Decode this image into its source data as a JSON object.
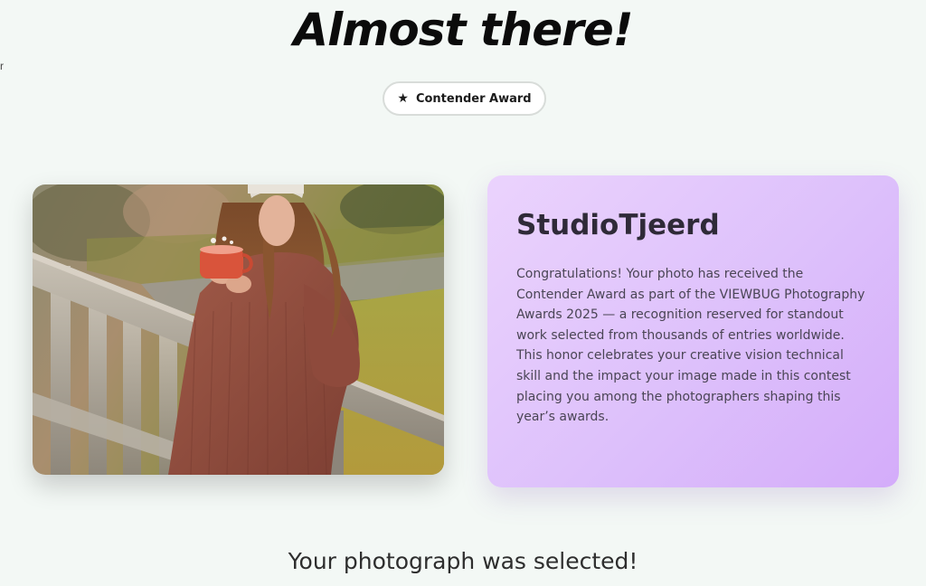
{
  "edge_glyph": "r",
  "headline": "Almost there!",
  "award_badge": {
    "icon": "star-icon",
    "icon_glyph": "★",
    "label": "Contender Award"
  },
  "photo": {
    "icon": "photo-image",
    "alt": "Woman in knit sweater holding a mug beside wooden fence"
  },
  "info_card": {
    "artist": "StudioTjeerd",
    "description": "Congratulations! Your photo has received the Contender Award as part of the VIEWBUG Photography Awards 2025 — a recognition reserved for standout work selected from thousands of entries worldwide. This honor celebrates your creative vision technical skill and the impact your image made in this contest placing you among the photographers shaping this year’s awards."
  },
  "selected_caption": "Your photograph was selected!",
  "colors": {
    "background": "#f3f8f5",
    "card_gradient_start": "#ebd3fd",
    "card_gradient_end": "#d4acfa",
    "headline": "#0b0b0b"
  }
}
